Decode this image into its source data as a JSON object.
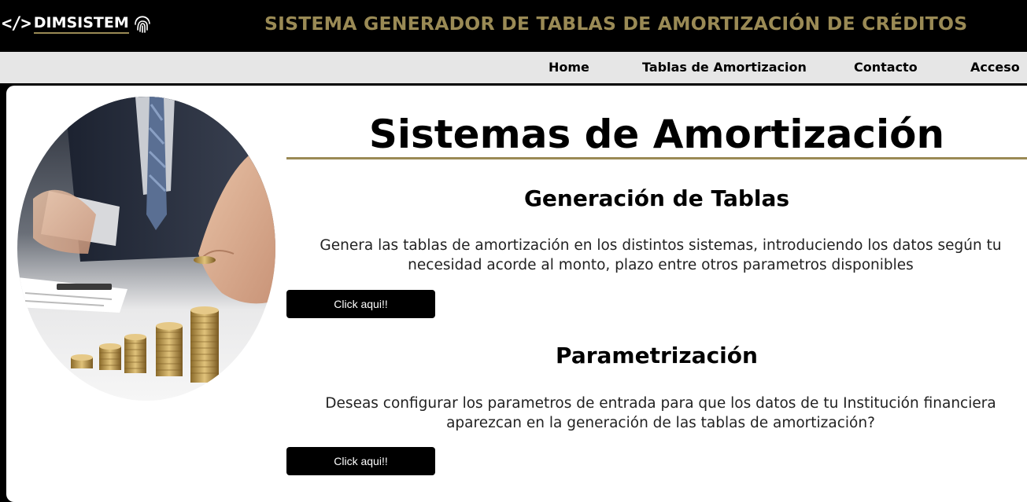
{
  "header": {
    "logo_code": "</>",
    "logo_text": "DIMSISTEM",
    "title": "SISTEMA GENERADOR DE TABLAS DE AMORTIZACIÓN DE CRÉDITOS"
  },
  "nav": {
    "items": [
      {
        "label": "Home"
      },
      {
        "label": "Tablas de Amortizacion"
      },
      {
        "label": "Contacto"
      },
      {
        "label": "Acceso"
      }
    ]
  },
  "main": {
    "title": "Sistemas de Amortización",
    "sections": [
      {
        "title": "Generación de Tablas",
        "text": "Genera las tablas de amortización en los distintos sistemas, introduciendo los datos según tu necesidad acorde al monto, plazo entre otros parametros disponibles",
        "button_label": "Click aqui!!"
      },
      {
        "title": "Parametrización",
        "text": "Deseas configurar los parametros de entrada para que los datos de tu Institución financiera aparezcan en la generación de las tablas de amortización?",
        "button_label": "Click aqui!!"
      }
    ]
  },
  "colors": {
    "accent_gold": "#9a8a55",
    "header_bg": "#000000",
    "nav_bg": "#e6e6e6"
  },
  "icons": {
    "logo_code": "code-icon",
    "logo_mark": "fingerprint-icon",
    "hero": "coins-hand-photo"
  }
}
